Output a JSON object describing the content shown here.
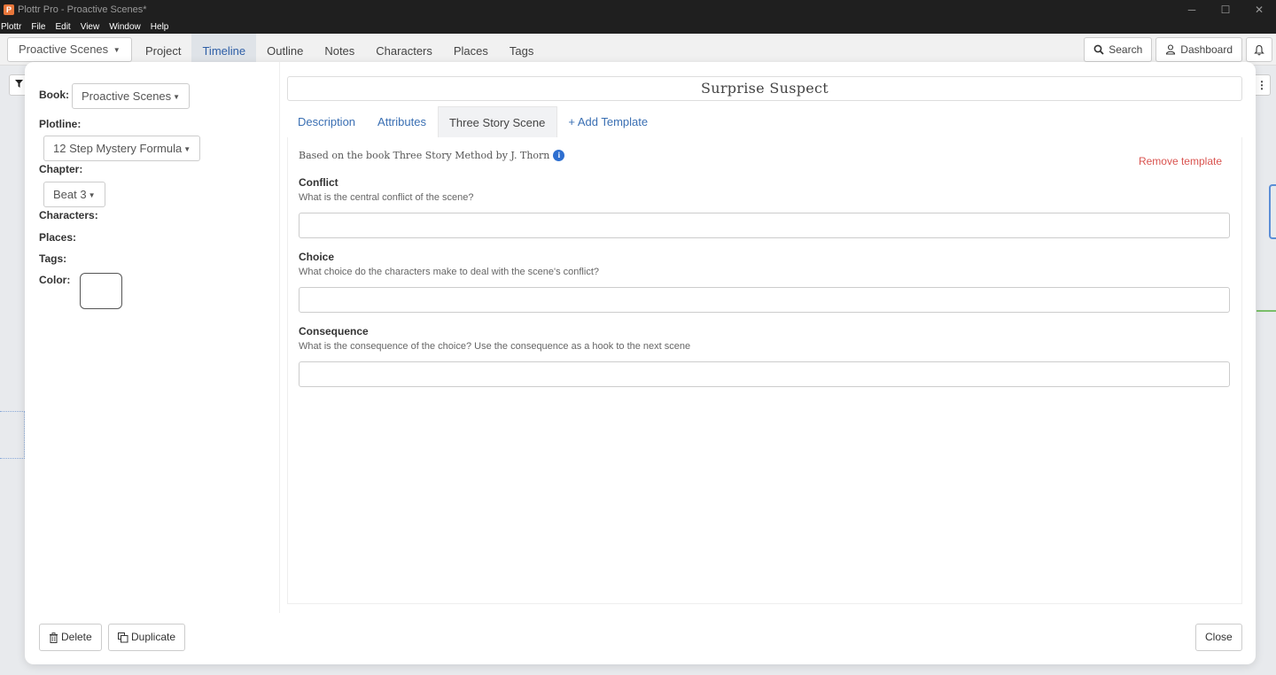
{
  "window": {
    "title": "Plottr Pro - Proactive Scenes*",
    "icon": "P",
    "controls": [
      "─",
      "☐",
      "✕"
    ]
  },
  "menu": [
    "Plottr",
    "File",
    "Edit",
    "View",
    "Window",
    "Help"
  ],
  "nav": {
    "book_selector": "Proactive Scenes",
    "tabs": [
      "Project",
      "Timeline",
      "Outline",
      "Notes",
      "Characters",
      "Places",
      "Tags"
    ],
    "active_tab": "Timeline",
    "search_label": "Search",
    "dashboard_label": "Dashboard"
  },
  "modal": {
    "left": {
      "book_label": "Book:",
      "book_value": "Proactive Scenes",
      "plotline_label": "Plotline:",
      "plotline_value": "12 Step Mystery Formula",
      "chapter_label": "Chapter:",
      "chapter_value": "Beat 3",
      "characters_label": "Characters:",
      "places_label": "Places:",
      "tags_label": "Tags:",
      "color_label": "Color:"
    },
    "scene_title": "Surprise Suspect",
    "tabs": [
      "Description",
      "Attributes",
      "Three Story Scene",
      "+ Add Template"
    ],
    "active_tab": "Three Story Scene",
    "template": {
      "based_on": "Based on the book Three Story Method by J. Thorn",
      "remove_label": "Remove template",
      "fields": [
        {
          "title": "Conflict",
          "description": "What is the central conflict of the scene?",
          "value": ""
        },
        {
          "title": "Choice",
          "description": "What choice do the characters make to deal with the scene's conflict?",
          "value": ""
        },
        {
          "title": "Consequence",
          "description": "What is the consequence of the choice? Use the consequence as a hook to the next scene",
          "value": ""
        }
      ]
    },
    "footer": {
      "delete_label": "Delete",
      "duplicate_label": "Duplicate",
      "close_label": "Close"
    }
  },
  "colors": {
    "link": "#3a6fb3",
    "danger": "#d9534f",
    "titlebar": "#1f1f1f"
  }
}
